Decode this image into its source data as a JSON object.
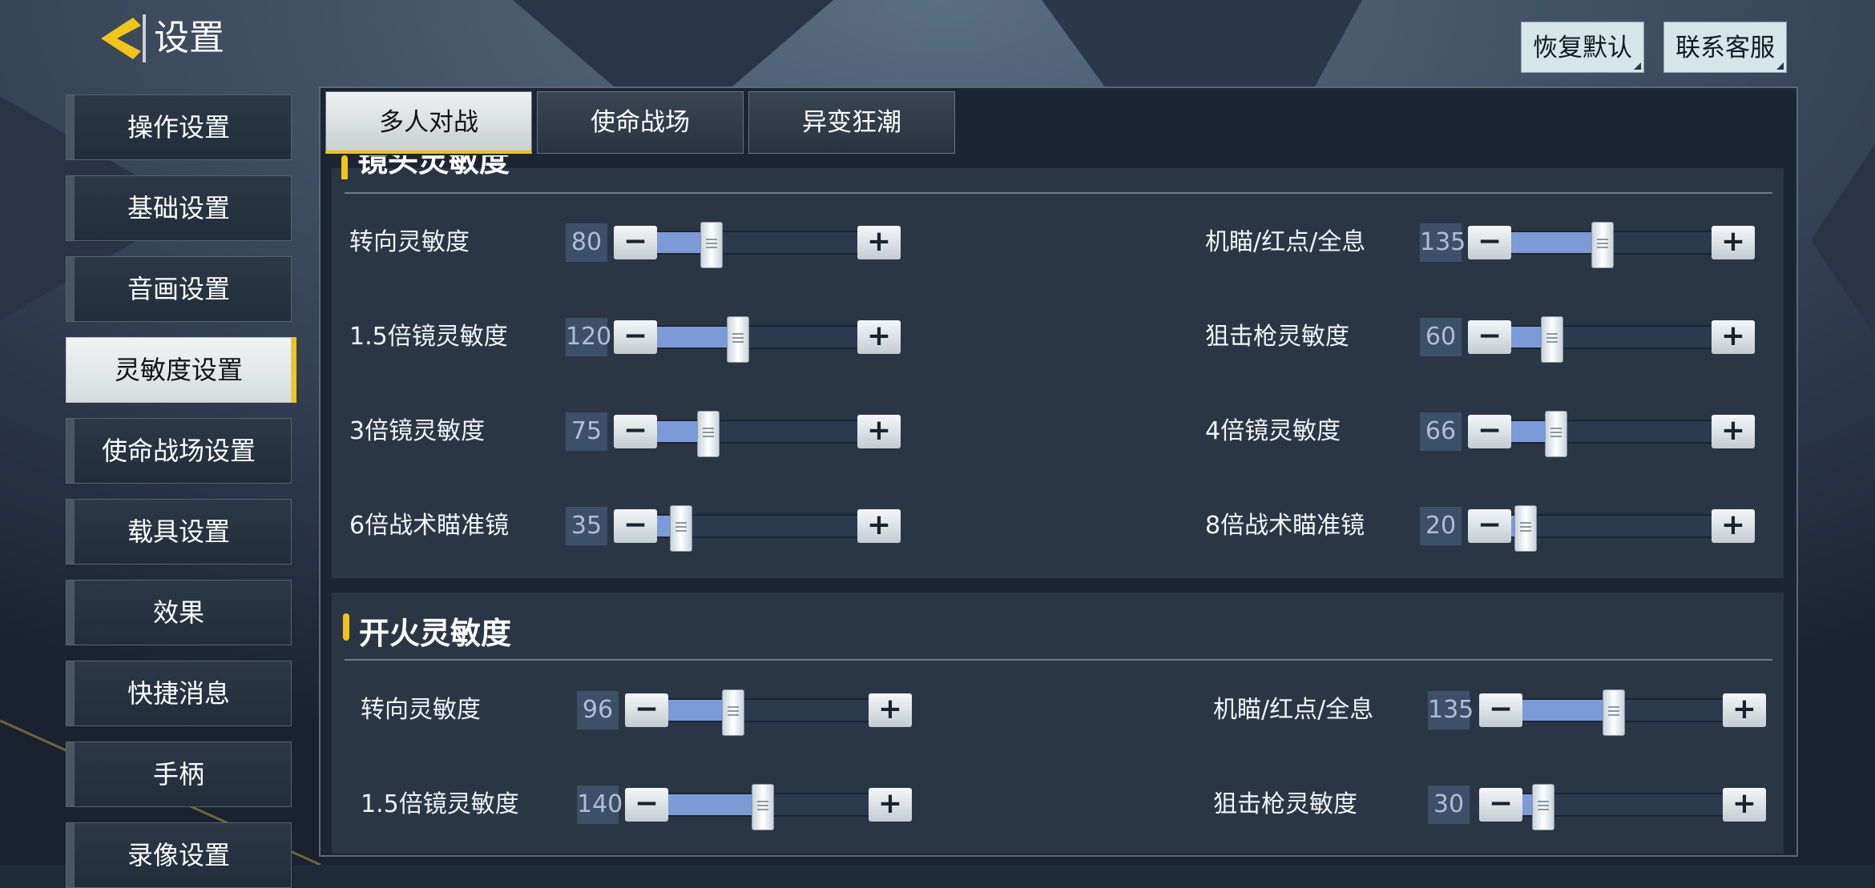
{
  "header": {
    "title": "设置",
    "restore_label": "恢复默认",
    "contact_label": "联系客服"
  },
  "sidebar": {
    "items": [
      {
        "label": "操作设置"
      },
      {
        "label": "基础设置"
      },
      {
        "label": "音画设置"
      },
      {
        "label": "灵敏度设置"
      },
      {
        "label": "使命战场设置"
      },
      {
        "label": "载具设置"
      },
      {
        "label": "效果"
      },
      {
        "label": "快捷消息"
      },
      {
        "label": "手柄"
      },
      {
        "label": "录像设置"
      }
    ],
    "active_index": 3
  },
  "tabs": [
    {
      "label": "多人对战"
    },
    {
      "label": "使命战场"
    },
    {
      "label": "异变狂潮"
    }
  ],
  "active_tab_index": 0,
  "accent_color": "#f0c419",
  "slider_fill_color": "#7b9ad6",
  "slider_max": 300,
  "section1": {
    "title": "镜头灵敏度",
    "left": [
      {
        "label": "转向灵敏度",
        "value": "80"
      },
      {
        "label": "1.5倍镜灵敏度",
        "value": "120"
      },
      {
        "label": "3倍镜灵敏度",
        "value": "75"
      },
      {
        "label": "6倍战术瞄准镜",
        "value": "35"
      }
    ],
    "right": [
      {
        "label": "机瞄/红点/全息",
        "value": "135"
      },
      {
        "label": "狙击枪灵敏度",
        "value": "60"
      },
      {
        "label": "4倍镜灵敏度",
        "value": "66"
      },
      {
        "label": "8倍战术瞄准镜",
        "value": "20"
      }
    ]
  },
  "section2": {
    "title": "开火灵敏度",
    "left": [
      {
        "label": "转向灵敏度",
        "value": "96"
      },
      {
        "label": "1.5倍镜灵敏度",
        "value": "140"
      }
    ],
    "right": [
      {
        "label": "机瞄/红点/全息",
        "value": "135"
      },
      {
        "label": "狙击枪灵敏度",
        "value": "30"
      }
    ]
  },
  "icons": {
    "back": "back-arrow-icon",
    "minus": "minus-icon",
    "plus": "plus-icon"
  }
}
